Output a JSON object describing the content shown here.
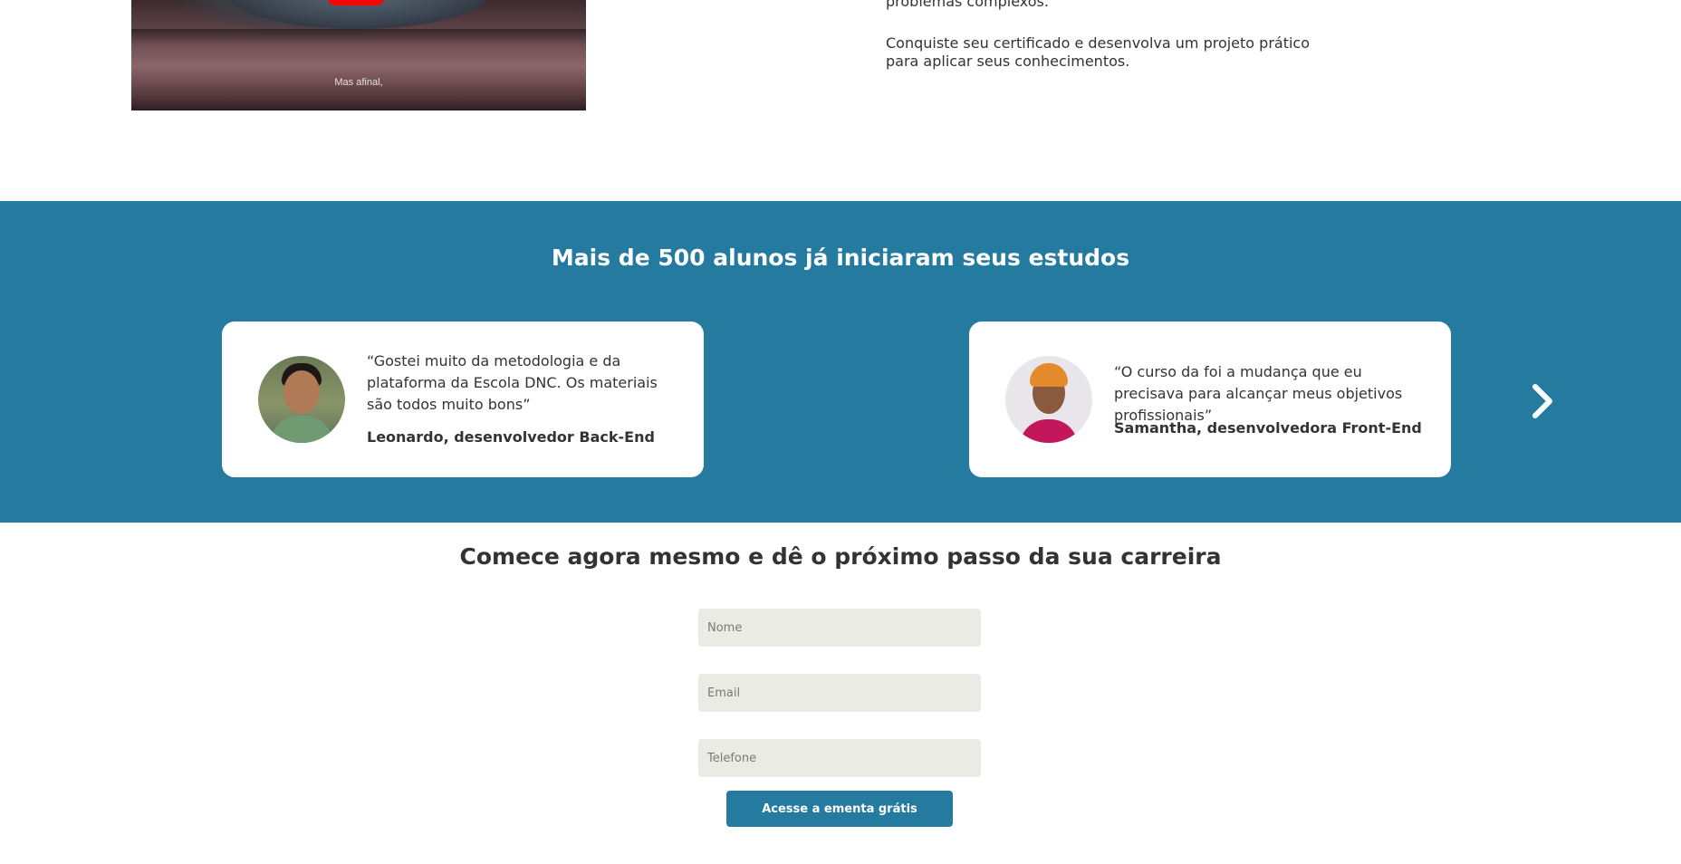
{
  "intro": {
    "video_caption": "Mas afinal,",
    "description_line_1": "problemas complexos.",
    "description_line_2": "Conquiste seu certificado e desenvolva um projeto prático para aplicar seus conhecimentos."
  },
  "testimonials": {
    "title": "Mais de 500 alunos já iniciaram seus estudos",
    "items": [
      {
        "quote": "“Gostei muito da metodologia e da plataforma da Escola DNC. Os materiais são todos muito bons”",
        "author": "Leonardo, desenvolvedor Back-End"
      },
      {
        "quote": "“O curso da foi a mudança que eu precisava para alcançar meus objetivos profissionais”",
        "author": "Samantha, desenvolvedora Front-End"
      }
    ],
    "next_icon": "chevron-right-icon"
  },
  "signup": {
    "title": "Comece agora mesmo e dê o próximo passo da sua carreira",
    "name_placeholder": "Nome",
    "email_placeholder": "Email",
    "phone_placeholder": "Telefone",
    "submit_label": "Acesse a ementa grátis"
  },
  "colors": {
    "brand": "#247b9f",
    "input_bg": "#ebebe5",
    "text": "#333333"
  }
}
